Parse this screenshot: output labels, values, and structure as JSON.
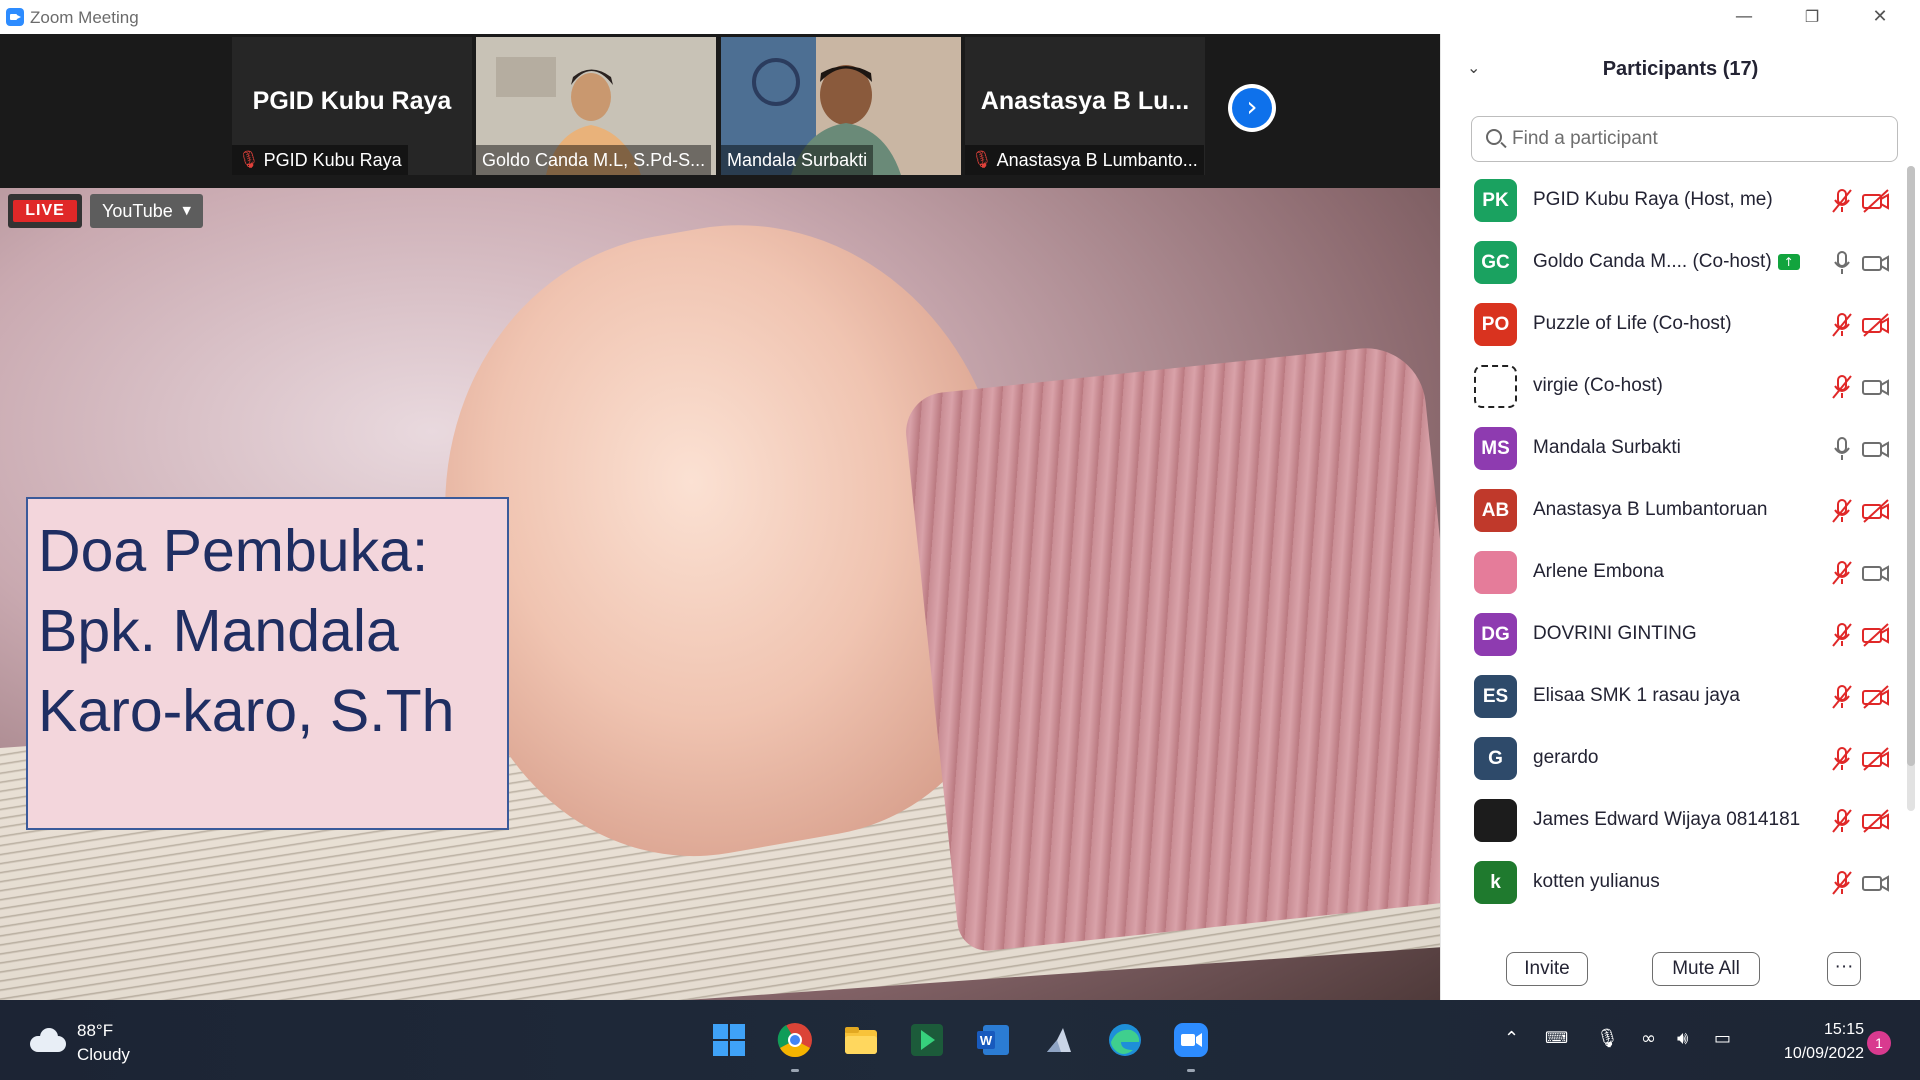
{
  "window": {
    "title": "Zoom Meeting"
  },
  "strip": {
    "tiles": [
      {
        "big_name": "PGID Kubu Raya",
        "label": "PGID Kubu Raya",
        "muted": true
      },
      {
        "big_name": "",
        "label": "Goldo Canda M.L, S.Pd-S...",
        "muted": false
      },
      {
        "big_name": "",
        "label": "Mandala Surbakti",
        "muted": false,
        "active": true
      },
      {
        "big_name": "Anastasya B Lu...",
        "label": "Anastasya B Lumbanto...",
        "muted": true
      }
    ],
    "next_icon": "chevron-right-icon"
  },
  "share": {
    "live_label": "LIVE",
    "stream_dropdown": "YouTube",
    "text_lines": [
      "Doa Pembuka:",
      "Bpk. Mandala",
      "Karo-karo, S.Th"
    ]
  },
  "panel": {
    "title": "Participants (17)",
    "search_placeholder": "Find a participant",
    "participants": [
      {
        "initials": "PK",
        "color": "#1aa260",
        "name": "PGID Kubu Raya (Host, me)",
        "mic": "muted",
        "video": "off"
      },
      {
        "initials": "GC",
        "color": "#1aa260",
        "name": "Goldo Canda M....  (Co-host)",
        "sharing": true,
        "mic": "on",
        "video": "on"
      },
      {
        "initials": "PO",
        "color": "#d9331f",
        "name": "Puzzle of Life (Co-host)",
        "mic": "muted",
        "video": "off"
      },
      {
        "initials": "",
        "color": "#ffffff",
        "name": "virgie (Co-host)",
        "mic": "muted",
        "video": "on"
      },
      {
        "initials": "MS",
        "color": "#8e3bb0",
        "name": "Mandala Surbakti",
        "mic": "on",
        "video": "on"
      },
      {
        "initials": "AB",
        "color": "#c0392b",
        "name": "Anastasya B Lumbantoruan",
        "mic": "muted",
        "video": "off"
      },
      {
        "initials": "",
        "color": "#e57c9a",
        "name": "Arlene Embona",
        "mic": "muted",
        "video": "on"
      },
      {
        "initials": "DG",
        "color": "#8e3bb0",
        "name": "DOVRINI GINTING",
        "mic": "muted",
        "video": "off"
      },
      {
        "initials": "ES",
        "color": "#2e4a6a",
        "name": "Elisaa SMK 1 rasau jaya",
        "mic": "muted",
        "video": "off"
      },
      {
        "initials": "G",
        "color": "#2e4a6a",
        "name": "gerardo",
        "mic": "muted",
        "video": "off"
      },
      {
        "initials": "",
        "color": "#1c1c1c",
        "name": "James Edward Wijaya 0814181",
        "mic": "muted",
        "video": "off"
      },
      {
        "initials": "k",
        "color": "#1f7a2e",
        "name": "kotten yulianus",
        "mic": "muted",
        "video": "on"
      }
    ],
    "buttons": {
      "invite": "Invite",
      "mute_all": "Mute All",
      "more": "···"
    }
  },
  "taskbar": {
    "weather_temp": "88°F",
    "weather_desc": "Cloudy",
    "apps": [
      "start-icon",
      "chrome-icon",
      "file-explorer-icon",
      "app-icon",
      "word-icon",
      "app-icon",
      "edge-icon",
      "zoom-icon"
    ],
    "time": "15:15",
    "date": "10/09/2022",
    "notification_count": "1"
  }
}
